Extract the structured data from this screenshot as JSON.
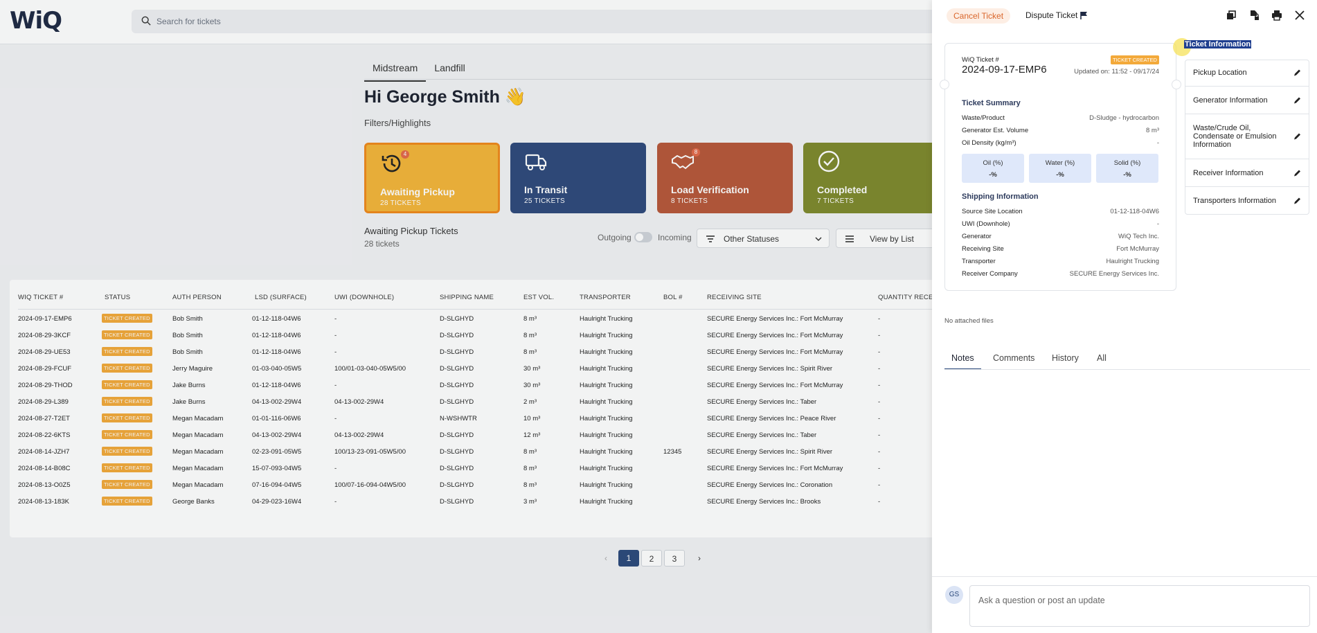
{
  "app": {
    "logo": "WiQ"
  },
  "search": {
    "placeholder": "Search for tickets"
  },
  "tabs": [
    {
      "label": "Midstream"
    },
    {
      "label": "Landfill"
    }
  ],
  "greeting": "Hi George Smith 👋",
  "filters_label": "Filters/Highlights",
  "cards": [
    {
      "title": "Awaiting Pickup",
      "sub": "28 TICKETS",
      "badge": "4",
      "icon": "history-icon"
    },
    {
      "title": "In Transit",
      "sub": "25 TICKETS",
      "icon": "truck-icon"
    },
    {
      "title": "Load Verification",
      "sub": "8 TICKETS",
      "badge": "8",
      "icon": "handshake-icon"
    },
    {
      "title": "Completed",
      "sub": "7 TICKETS",
      "icon": "check-circle-icon"
    }
  ],
  "section": {
    "title": "Awaiting Pickup Tickets",
    "sub": "28 tickets"
  },
  "toggle": {
    "outgoing": "Outgoing",
    "incoming": "Incoming"
  },
  "status_filter": "Other Statuses",
  "view_mode": "View by List",
  "table": {
    "headers": [
      "WIQ TICKET #",
      "STATUS",
      "AUTH PERSON",
      "LSD (SURFACE)",
      "UWI (DOWNHOLE)",
      "SHIPPING NAME",
      "EST VOL.",
      "TRANSPORTER",
      "BOL #",
      "RECEIVING SITE",
      "QUANTITY RECEI"
    ],
    "rows": [
      [
        "2024-09-17-EMP6",
        "TICKET CREATED",
        "Bob Smith",
        "01-12-118-04W6",
        "-",
        "D-SLGHYD",
        "8 m³",
        "Haulright Trucking",
        "",
        "SECURE Energy Services Inc.: Fort McMurray",
        "-"
      ],
      [
        "2024-08-29-3KCF",
        "TICKET CREATED",
        "Bob Smith",
        "01-12-118-04W6",
        "-",
        "D-SLGHYD",
        "8 m³",
        "Haulright Trucking",
        "",
        "SECURE Energy Services Inc.: Fort McMurray",
        "-"
      ],
      [
        "2024-08-29-UE53",
        "TICKET CREATED",
        "Bob Smith",
        "01-12-118-04W6",
        "-",
        "D-SLGHYD",
        "8 m³",
        "Haulright Trucking",
        "",
        "SECURE Energy Services Inc.: Fort McMurray",
        "-"
      ],
      [
        "2024-08-29-FCUF",
        "TICKET CREATED",
        "Jerry Maguire",
        "01-03-040-05W5",
        "100/01-03-040-05W5/00",
        "D-SLGHYD",
        "30 m³",
        "Haulright Trucking",
        "",
        "SECURE Energy Services Inc.: Spirit River",
        "-"
      ],
      [
        "2024-08-29-THOD",
        "TICKET CREATED",
        "Jake Burns",
        "01-12-118-04W6",
        "-",
        "D-SLGHYD",
        "30 m³",
        "Haulright Trucking",
        "",
        "SECURE Energy Services Inc.: Fort McMurray",
        "-"
      ],
      [
        "2024-08-29-L389",
        "TICKET CREATED",
        "Jake Burns",
        "04-13-002-29W4",
        "04-13-002-29W4",
        "D-SLGHYD",
        "2 m³",
        "Haulright Trucking",
        "",
        "SECURE Energy Services Inc.: Taber",
        "-"
      ],
      [
        "2024-08-27-T2ET",
        "TICKET CREATED",
        "Megan Macadam",
        "01-01-116-06W6",
        "-",
        "N-WSHWTR",
        "10 m³",
        "Haulright Trucking",
        "",
        "SECURE Energy Services Inc.: Peace River",
        "-"
      ],
      [
        "2024-08-22-6KTS",
        "TICKET CREATED",
        "Megan Macadam",
        "04-13-002-29W4",
        "04-13-002-29W4",
        "D-SLGHYD",
        "12 m³",
        "Haulright Trucking",
        "",
        "SECURE Energy Services Inc.: Taber",
        "-"
      ],
      [
        "2024-08-14-JZH7",
        "TICKET CREATED",
        "Megan Macadam",
        "02-23-091-05W5",
        "100/13-23-091-05W5/00",
        "D-SLGHYD",
        "8 m³",
        "Haulright Trucking",
        "12345",
        "SECURE Energy Services Inc.: Spirit River",
        "-"
      ],
      [
        "2024-08-14-B08C",
        "TICKET CREATED",
        "Megan Macadam",
        "15-07-093-04W5",
        "-",
        "D-SLGHYD",
        "8 m³",
        "Haulright Trucking",
        "",
        "SECURE Energy Services Inc.: Fort McMurray",
        "-"
      ],
      [
        "2024-08-13-O0Z5",
        "TICKET CREATED",
        "Megan Macadam",
        "07-16-094-04W5",
        "100/07-16-094-04W5/00",
        "D-SLGHYD",
        "8 m³",
        "Haulright Trucking",
        "",
        "SECURE Energy Services Inc.: Coronation",
        "-"
      ],
      [
        "2024-08-13-183K",
        "TICKET CREATED",
        "George Banks",
        "04-29-023-16W4",
        "-",
        "D-SLGHYD",
        "3 m³",
        "Haulright Trucking",
        "",
        "SECURE Energy Services Inc.: Brooks",
        "-"
      ]
    ]
  },
  "pagination": {
    "prev": "‹",
    "pages": [
      "1",
      "2",
      "3"
    ],
    "current": "1",
    "next": "›"
  },
  "drawer": {
    "cancel": "Cancel Ticket",
    "dispute": "Dispute Ticket",
    "ticket_label": "WiQ Ticket #",
    "ticket_id": "2024-09-17-EMP6",
    "status": "TICKET CREATED",
    "updated": "Updated on: 11:52 - 09/17/24",
    "summary_title": "Ticket Summary",
    "summary": [
      {
        "k": "Waste/Product",
        "v": "D-Sludge - hydrocarbon"
      },
      {
        "k": "Generator Est. Volume",
        "v": "8 m³"
      },
      {
        "k": "Oil Density (kg/m³)",
        "v": "-"
      }
    ],
    "pcts": [
      {
        "label": "Oil (%)",
        "value": "-%"
      },
      {
        "label": "Water (%)",
        "value": "-%"
      },
      {
        "label": "Solid (%)",
        "value": "-%"
      }
    ],
    "shipping_title": "Shipping Information",
    "shipping": [
      {
        "k": "Source Site Location",
        "v": "01-12-118-04W6"
      },
      {
        "k": "UWI (Downhole)",
        "v": "-"
      },
      {
        "k": "Generator",
        "v": "WiQ Tech Inc."
      },
      {
        "k": "Receiving Site",
        "v": "Fort McMurray"
      },
      {
        "k": "Transporter",
        "v": "Haulright Trucking"
      },
      {
        "k": "Receiver Company",
        "v": "SECURE Energy Services Inc."
      }
    ],
    "side_title": "Ticket Information",
    "side_items": [
      "Pickup Location",
      "Generator Information",
      "Waste/Crude Oil, Condensate or Emulsion Information",
      "Receiver Information",
      "Transporters Information"
    ],
    "no_files": "No attached files",
    "note_tabs": [
      "Notes",
      "Comments",
      "History",
      "All"
    ],
    "avatar": "GS",
    "ask_placeholder": "Ask a question or post an update"
  }
}
